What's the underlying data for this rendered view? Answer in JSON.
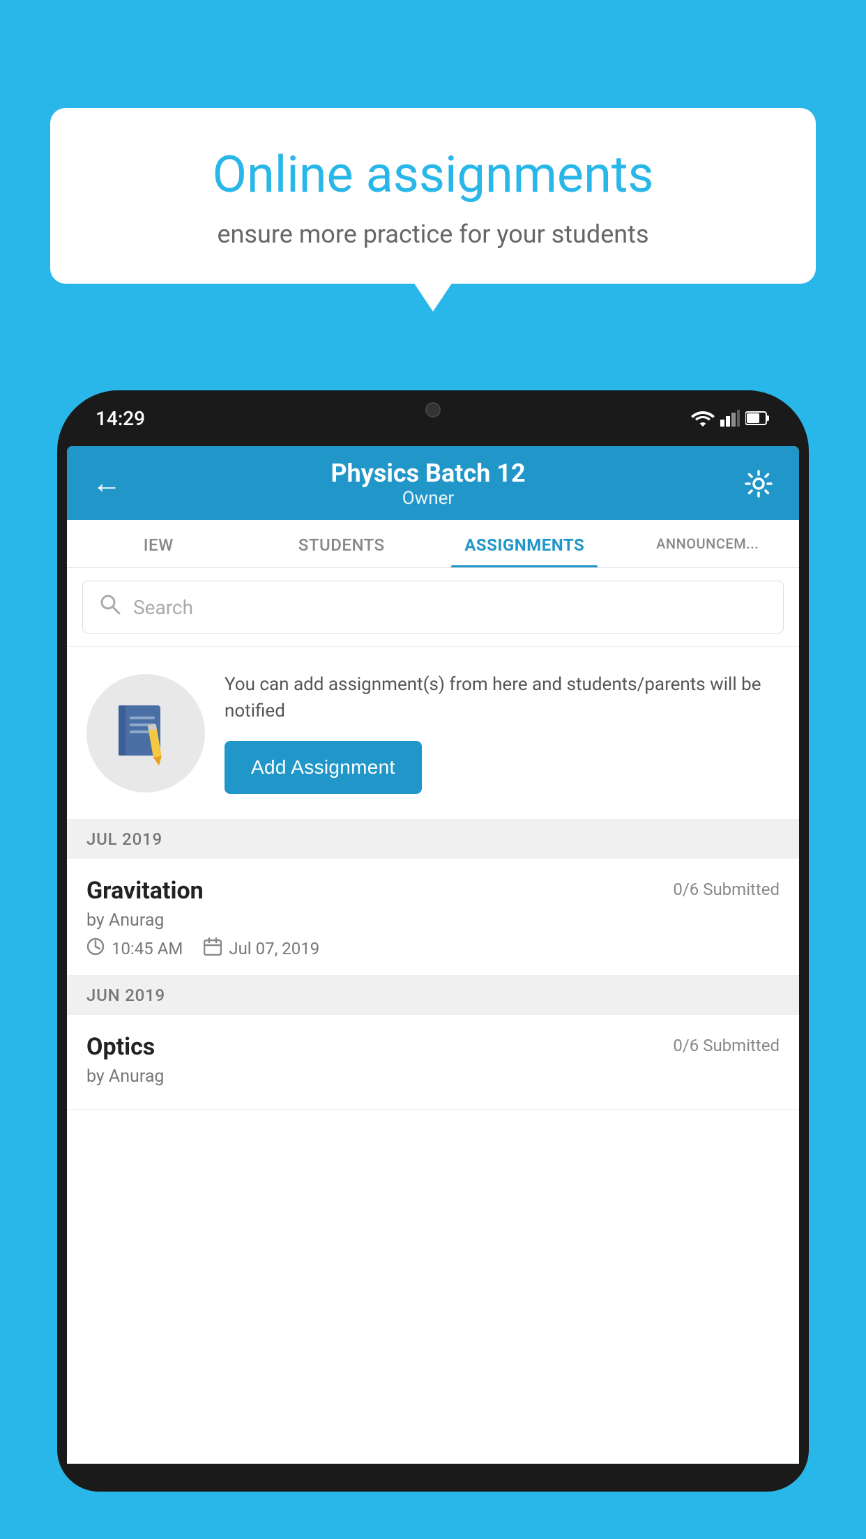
{
  "background_color": "#29b6e8",
  "speech_bubble": {
    "title": "Online assignments",
    "subtitle": "ensure more practice for your students"
  },
  "phone": {
    "status_bar": {
      "time": "14:29"
    },
    "header": {
      "title": "Physics Batch 12",
      "subtitle": "Owner",
      "back_label": "←",
      "settings_label": "⚙"
    },
    "tabs": [
      {
        "label": "IEW",
        "active": false
      },
      {
        "label": "STUDENTS",
        "active": false
      },
      {
        "label": "ASSIGNMENTS",
        "active": true
      },
      {
        "label": "ANNOUNCEM...",
        "active": false
      }
    ],
    "search": {
      "placeholder": "Search"
    },
    "info_section": {
      "text": "You can add assignment(s) from here and students/parents will be notified",
      "add_button_label": "Add Assignment"
    },
    "months": [
      {
        "label": "JUL 2019",
        "assignments": [
          {
            "name": "Gravitation",
            "submitted": "0/6 Submitted",
            "by": "by Anurag",
            "time": "10:45 AM",
            "date": "Jul 07, 2019"
          }
        ]
      },
      {
        "label": "JUN 2019",
        "assignments": [
          {
            "name": "Optics",
            "submitted": "0/6 Submitted",
            "by": "by Anurag",
            "time": "",
            "date": ""
          }
        ]
      }
    ]
  }
}
